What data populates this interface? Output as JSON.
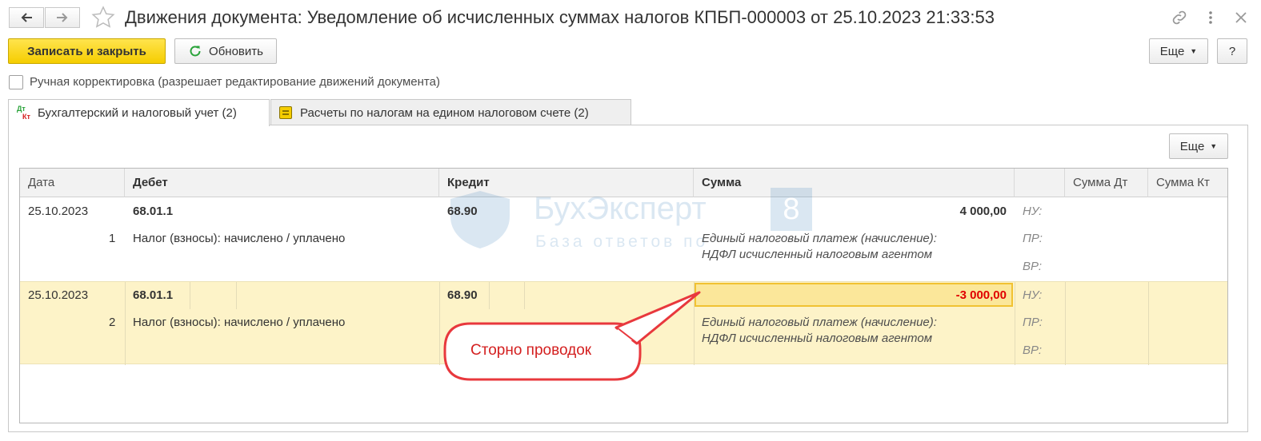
{
  "window": {
    "title": "Движения документа: Уведомление об исчисленных суммах налогов КПБП-000003 от 25.10.2023 21:33:53",
    "icons": [
      "arrow-left-icon",
      "arrow-right-icon",
      "star-icon",
      "link-icon",
      "kebab-menu-icon",
      "close-icon"
    ]
  },
  "toolbar": {
    "save_close_label": "Записать и закрыть",
    "refresh_label": "Обновить",
    "more_label": "Еще",
    "help_label": "?"
  },
  "manual_correction": {
    "label": "Ручная корректировка (разрешает редактирование движений документа)",
    "checked": false
  },
  "tabs": [
    {
      "icon_text": "Дт Кт",
      "label": "Бухгалтерский и налоговый учет (2)",
      "active": true
    },
    {
      "icon_text": "",
      "label": "Расчеты по налогам на едином налоговом счете (2)",
      "active": false
    }
  ],
  "panel_more_label": "Еще",
  "table": {
    "columns": [
      "Дата",
      "Дебет",
      "Кредит",
      "Сумма",
      "",
      "Сумма Дт",
      "Сумма Кт"
    ],
    "rows": [
      {
        "date": "25.10.2023",
        "number": "1",
        "debit": "68.01.1",
        "credit": "68.90",
        "description": "Налог (взносы): начислено / уплачено",
        "amount": "4 000,00",
        "amount_details": [
          "Единый налоговый платеж (начисление):",
          "НДФЛ исчисленный налоговым агентом"
        ],
        "labels": [
          "НУ:",
          "ПР:",
          "ВР:"
        ],
        "selected": false
      },
      {
        "date": "25.10.2023",
        "number": "2",
        "debit": "68.01.1",
        "credit": "68.90",
        "description": "Налог (взносы): начислено / уплачено",
        "amount": "-3 000,00",
        "amount_details": [
          "Единый налоговый платеж (начисление):",
          "НДФЛ исчисленный налоговым агентом"
        ],
        "labels": [
          "НУ:",
          "ПР:",
          "ВР:"
        ],
        "selected": true
      }
    ]
  },
  "watermark": {
    "brand": "БухЭксперт",
    "badge": "8",
    "subtitle": "База ответов по"
  },
  "callout": {
    "text": "Сторно проводок"
  },
  "colors": {
    "primary_button": "#f5cd00",
    "selected_row": "#fdf3c8",
    "negative_amount": "#e00000",
    "callout_border": "#e8383d"
  }
}
